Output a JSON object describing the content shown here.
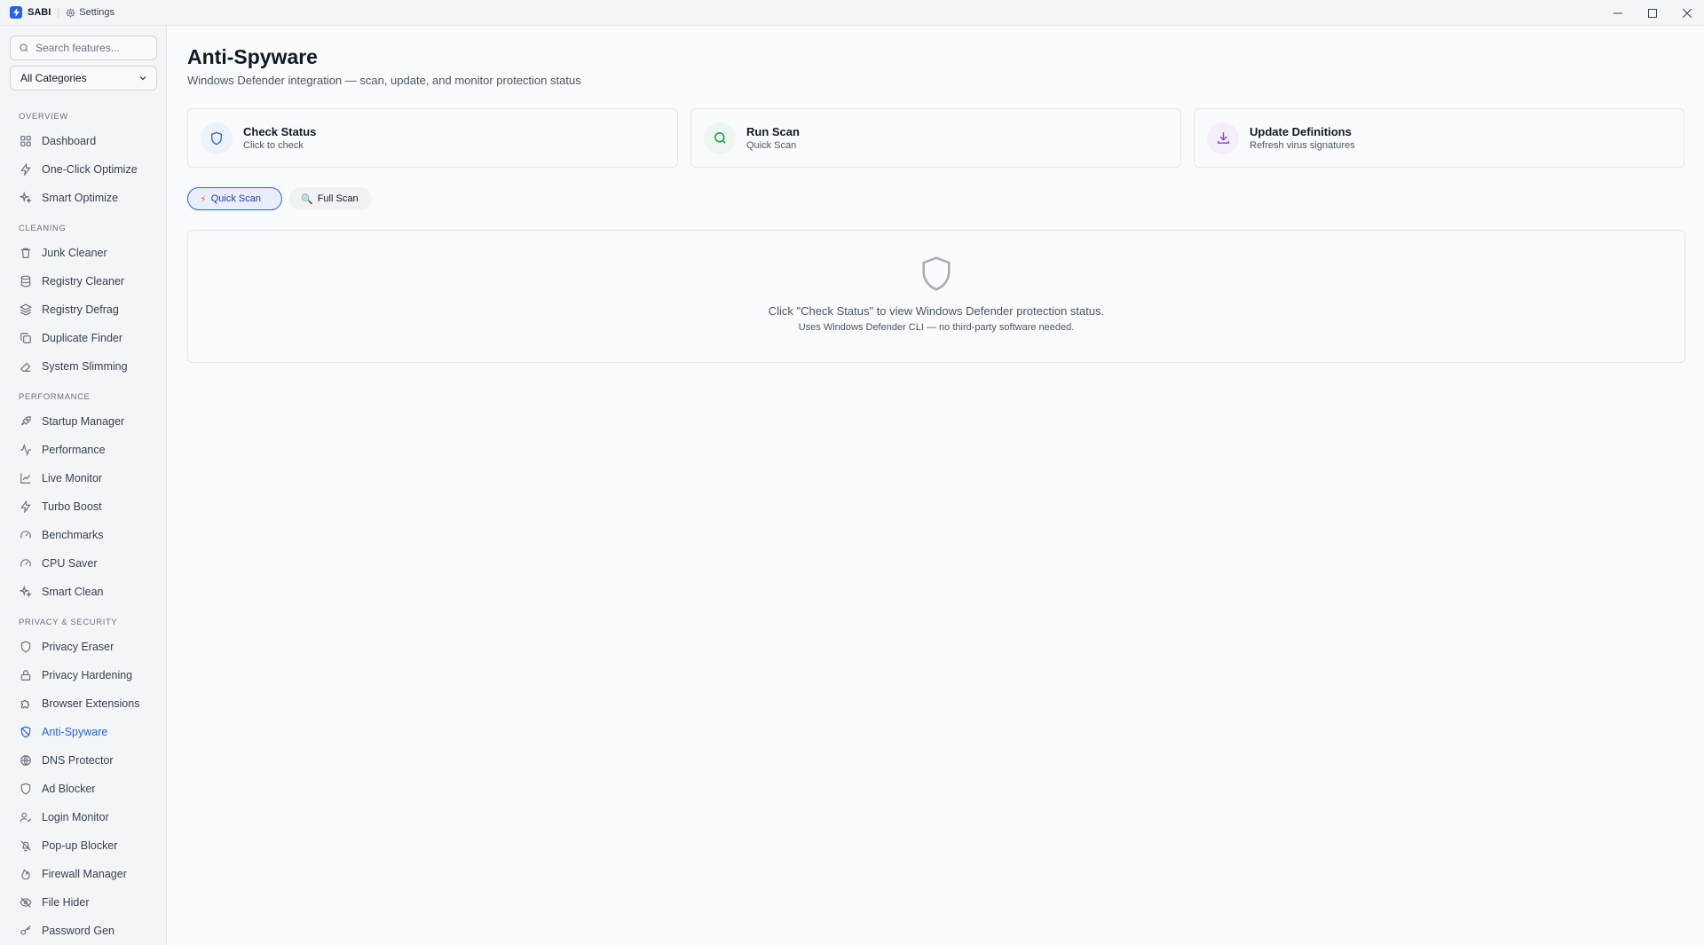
{
  "titlebar": {
    "app_name": "SABI",
    "settings_label": "Settings"
  },
  "sidebar": {
    "search": {
      "placeholder": "Search features...",
      "value": ""
    },
    "category_select": {
      "selected": "All Categories"
    },
    "sections": [
      {
        "label": "OVERVIEW",
        "items": [
          {
            "label": "Dashboard",
            "icon": "grid-icon"
          },
          {
            "label": "One-Click Optimize",
            "icon": "bolt-icon"
          },
          {
            "label": "Smart Optimize",
            "icon": "sparkles-icon"
          }
        ]
      },
      {
        "label": "CLEANING",
        "items": [
          {
            "label": "Junk Cleaner",
            "icon": "trash-icon"
          },
          {
            "label": "Registry Cleaner",
            "icon": "database-icon"
          },
          {
            "label": "Registry Defrag",
            "icon": "layers-icon"
          },
          {
            "label": "Duplicate Finder",
            "icon": "copy-icon"
          },
          {
            "label": "System Slimming",
            "icon": "eraser-icon"
          }
        ]
      },
      {
        "label": "PERFORMANCE",
        "items": [
          {
            "label": "Startup Manager",
            "icon": "rocket-icon"
          },
          {
            "label": "Performance",
            "icon": "activity-icon"
          },
          {
            "label": "Live Monitor",
            "icon": "chart-line-icon"
          },
          {
            "label": "Turbo Boost",
            "icon": "bolt-icon"
          },
          {
            "label": "Benchmarks",
            "icon": "gauge-icon"
          },
          {
            "label": "CPU Saver",
            "icon": "gauge-icon"
          },
          {
            "label": "Smart Clean",
            "icon": "sparkles-icon"
          }
        ]
      },
      {
        "label": "PRIVACY & SECURITY",
        "items": [
          {
            "label": "Privacy Eraser",
            "icon": "shield-icon"
          },
          {
            "label": "Privacy Hardening",
            "icon": "lock-icon"
          },
          {
            "label": "Browser Extensions",
            "icon": "puzzle-icon"
          },
          {
            "label": "Anti-Spyware",
            "icon": "shield-off-icon",
            "active": true
          },
          {
            "label": "DNS Protector",
            "icon": "globe-icon"
          },
          {
            "label": "Ad Blocker",
            "icon": "shield-icon"
          },
          {
            "label": "Login Monitor",
            "icon": "user-check-icon"
          },
          {
            "label": "Pop-up Blocker",
            "icon": "bell-off-icon"
          },
          {
            "label": "Firewall Manager",
            "icon": "flame-icon"
          },
          {
            "label": "File Hider",
            "icon": "eye-off-icon"
          },
          {
            "label": "Password Gen",
            "icon": "key-icon"
          }
        ]
      }
    ]
  },
  "main": {
    "title": "Anti-Spyware",
    "subtitle": "Windows Defender integration — scan, update, and monitor protection status",
    "cards": [
      {
        "title": "Check Status",
        "subtitle": "Click to check",
        "icon": "shield-icon",
        "accent": "#2563eb",
        "bg": "#eef2fb"
      },
      {
        "title": "Run Scan",
        "subtitle": "Quick Scan",
        "icon": "search-icon",
        "accent": "#16a34a",
        "bg": "#edf7f0"
      },
      {
        "title": "Update Definitions",
        "subtitle": "Refresh virus signatures",
        "icon": "download-icon",
        "accent": "#9333ea",
        "bg": "#f5effb"
      }
    ],
    "scan_modes": [
      {
        "label": "Quick Scan",
        "icon": "⚡",
        "active": true
      },
      {
        "label": "Full Scan",
        "icon": "🔍",
        "active": false
      }
    ],
    "empty_state": {
      "icon": "shield-icon",
      "message": "Click \"Check Status\" to view Windows Defender protection status.",
      "note": "Uses Windows Defender CLI — no third-party software needed."
    }
  },
  "colors": {
    "accent": "#2563eb",
    "text_primary": "#111827",
    "text_secondary": "#4b5563",
    "border": "#e5e7eb"
  }
}
